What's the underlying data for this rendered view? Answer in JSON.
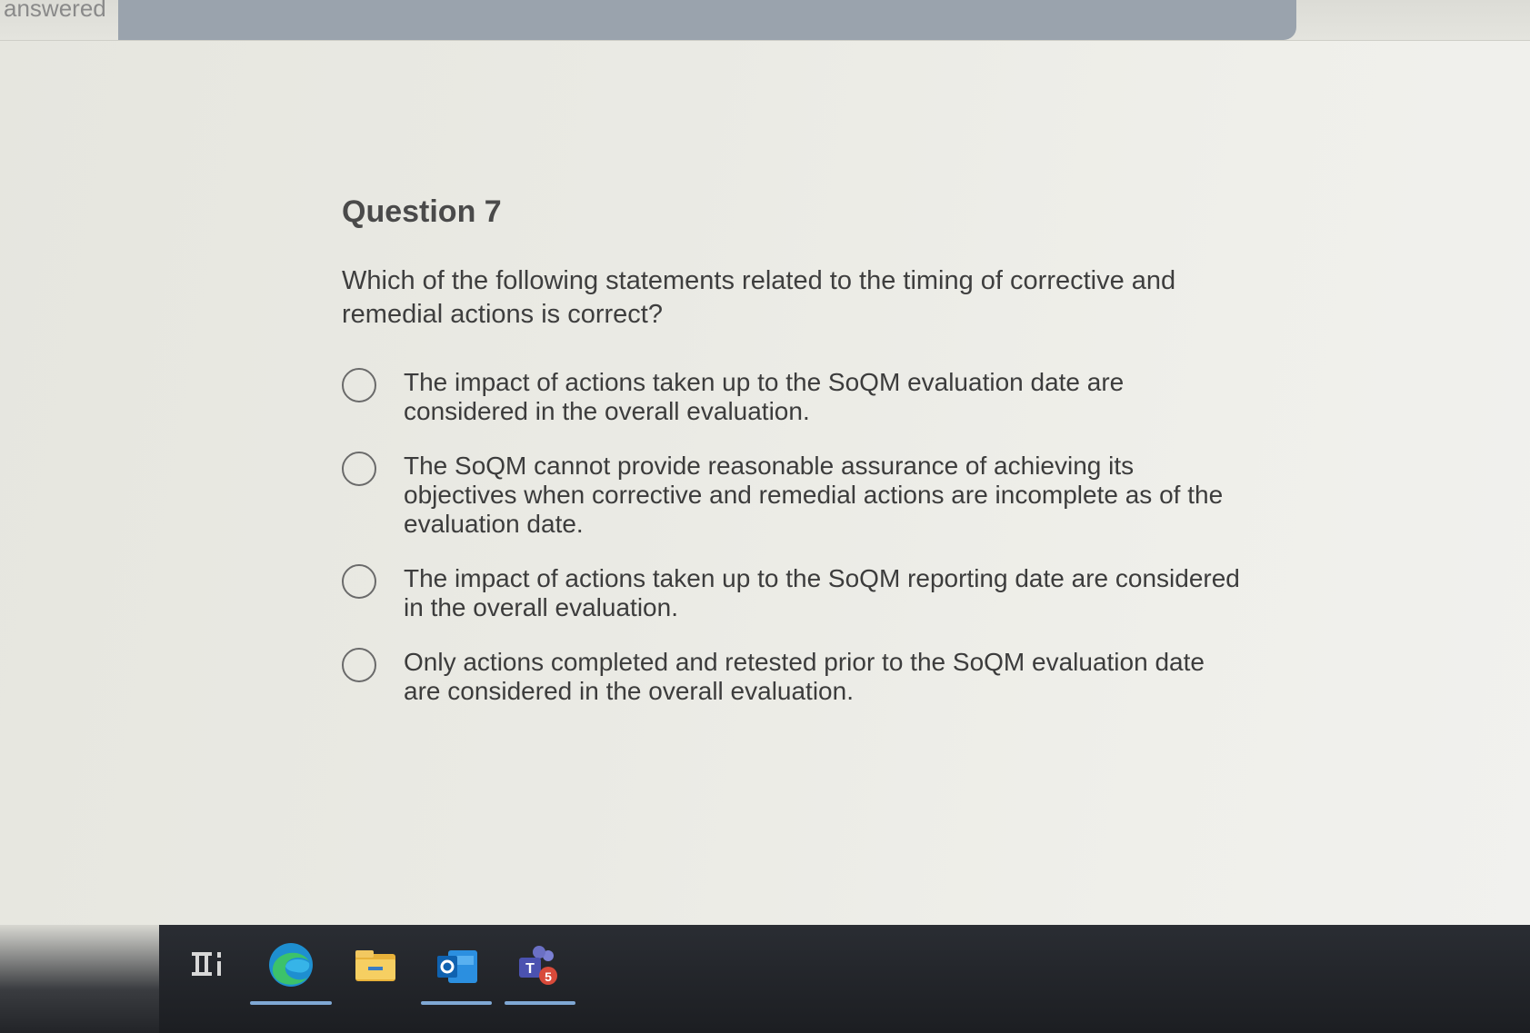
{
  "progress": {
    "label": "answered",
    "fraction": 0.77
  },
  "question": {
    "title": "Question 7",
    "text": "Which of the following statements related to the timing of corrective and remedial actions is correct?",
    "options": [
      {
        "label": "The impact of actions taken up to the SoQM evaluation date are considered in the overall evaluation."
      },
      {
        "label": "The SoQM cannot provide reasonable assurance of achieving its objectives when corrective and remedial actions are incomplete as of the evaluation date."
      },
      {
        "label": "The impact of actions taken up to the SoQM reporting date are considered in the overall evaluation."
      },
      {
        "label": "Only actions completed and retested prior to the SoQM evaluation date are considered in the overall evaluation."
      }
    ]
  },
  "taskbar": {
    "icons": [
      {
        "name": "widgets-icon"
      },
      {
        "name": "edge-browser-icon",
        "color": "#2fa3d8"
      },
      {
        "name": "file-explorer-icon",
        "color": "#f2c34a"
      },
      {
        "name": "outlook-icon",
        "color": "#1a74c9"
      },
      {
        "name": "teams-icon",
        "color": "#6b70c4",
        "badge": "5"
      }
    ]
  }
}
